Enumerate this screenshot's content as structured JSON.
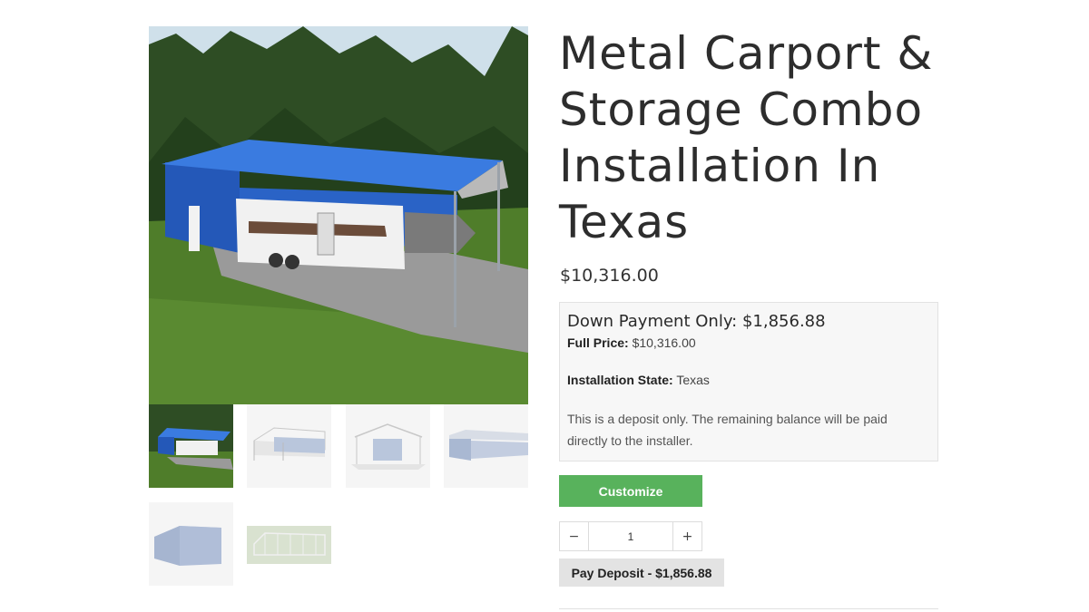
{
  "gallery": {
    "main_image": "metal-carport-storage-combo-photo",
    "thumbnails": [
      "carport-combo-photo-thumbnail",
      "open-carport-side-render",
      "carport-front-render",
      "carport-side-enclosed-render",
      "enclosed-building-render",
      "frame-structure-render"
    ]
  },
  "product": {
    "title": "Metal Carport & Storage Combo Installation In Texas",
    "price": "$10,316.00"
  },
  "deposit": {
    "heading": "Down Payment Only: $1,856.88",
    "full_price_label": "Full Price:",
    "full_price_value": "$10,316.00",
    "state_label": "Installation State:",
    "state_value": "Texas",
    "note": "This is a deposit only. The remaining balance will be paid directly to the installer."
  },
  "actions": {
    "customize_label": "Customize",
    "qty_minus": "−",
    "qty_plus": "+",
    "qty_value": "1",
    "pay_label": "Pay Deposit - $1,856.88"
  },
  "colors": {
    "customize_bg": "#58b25c",
    "roof_blue": "#2f6fd6"
  }
}
